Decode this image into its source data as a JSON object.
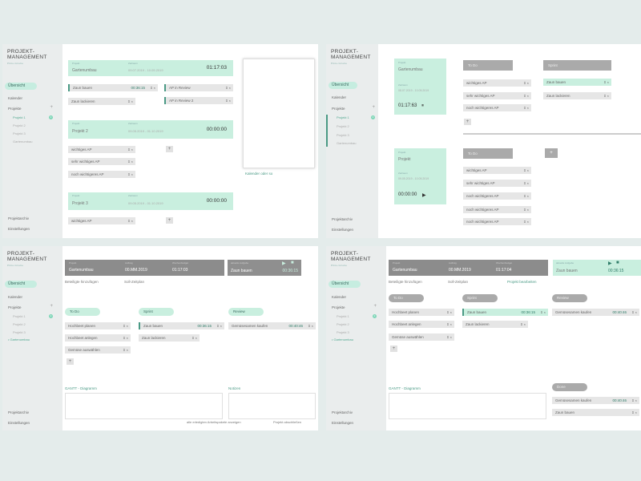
{
  "brand": {
    "title1": "PROJEKT-",
    "title2": "MANAGEMENT",
    "subtitle": "Pikto-Griebe"
  },
  "nav": {
    "overview": "Übersicht",
    "calendar": "Kalender",
    "projects": "Projekte",
    "p1": "Projekt 1",
    "p2": "Projekt 2",
    "p3": "Projekt 3",
    "garden": "Gartenumbau",
    "garden_bullet": "• Gartenumbau",
    "badge": "2",
    "archive": "Projektarchiv",
    "settings": "Einstellungen"
  },
  "labels": {
    "projekt": "Projekt",
    "zeitraum": "Zeitraum",
    "auftrag": "Auftrag",
    "wochenbudget": "Wochenbudget",
    "aktuelle_aufgabe": "aktuelle Aufgabe"
  },
  "ctl": {
    "pri": "⇕ ×",
    "x": "×"
  },
  "p1": {
    "card1": {
      "name": "Gartenumbau",
      "range": "09.07.2019 - 10.05.2019",
      "timer": "01:17:03"
    },
    "tasks1": [
      "Zaun bauen",
      "Zaun lackieren"
    ],
    "task1_time": "00:36:15",
    "side_tasks": [
      "AP in Review",
      "AP in Review 2"
    ],
    "card2": {
      "name": "Projekt 2",
      "range": "09.05.2019 - 01.10.2019",
      "timer": "00:00:00"
    },
    "tasks2": [
      "wichtiges AP",
      "sehr wichtiges AP",
      "noch wichtigeres AP"
    ],
    "card3": {
      "name": "Projekt 3",
      "range": "09.05.2019 - 01.10.2019",
      "timer": "00:00:00"
    },
    "tasks3": [
      "wichtiges AP"
    ],
    "calendar_link": "Kalender oder so"
  },
  "p2": {
    "card1": {
      "name": "Gartenumbau",
      "range": "08.07.2019 - 10.05.2019",
      "timer": "01:17:63",
      "pause": "⏸"
    },
    "todo1": "To Do",
    "todo1_tasks": [
      "wichtiges AP",
      "sehr wichtiges AP",
      "noch wichtigeres AP"
    ],
    "sprint": "Sprint",
    "sprint_tasks": [
      "Zaun bauen",
      "Zaun lackieren"
    ],
    "card2": {
      "name": "Projekt",
      "range": "09.05.2019 - 10.05.2019",
      "timer": "00:00:00",
      "play": "▶"
    },
    "todo2": "To Do",
    "todo2_tasks": [
      "wichtiges AP",
      "sehr wichtiges AP",
      "noch wichtigeres AP",
      "noch wichtigeres AP",
      "noch wichtigeres AP"
    ]
  },
  "p3": {
    "header": {
      "projekt": "Gartenumbau",
      "auftrag": "00.MM.2019",
      "budget": "01:17:03"
    },
    "current": {
      "task": "Zaun bauen",
      "timer": "00:36:15",
      "play": "▶",
      "stop": "■"
    },
    "links": {
      "beteiligte": "Beteiligte hinzufügen",
      "soll": "Soll-Zeitplan"
    },
    "col_todo": "To Do",
    "col_todo_tasks": [
      "Hochbeet planen",
      "Hochbeet anlegen",
      "Gemüse auswählen"
    ],
    "col_sprint": "Sprint",
    "col_sprint_tasks": [
      "Zaun bauen",
      "Zaun lackieren"
    ],
    "sprint_time": "00:36:15",
    "col_review": "Review",
    "col_review_tasks": [
      "Gemüsesamen kaufen"
    ],
    "review_time": "00:40:46",
    "gantt": "GANTT - Diagramm",
    "notes": "Notizen",
    "show_all": "alle erledigten Arbeitspakete anzeigen",
    "finish": "Projekt abschließen"
  },
  "p4": {
    "header": {
      "projekt": "Gartenumbau",
      "auftrag": "00.MM.2019",
      "budget": "01:17:04"
    },
    "current": {
      "task": "Zaun bauen",
      "timer": "00:36:15",
      "play": "▶",
      "stop": "■"
    },
    "links": {
      "beteiligte": "Beteiligte hinzufügen",
      "soll": "Soll-Zeitplan",
      "edit": "Projekt bearbeiten"
    },
    "col_todo": "To Do",
    "col_todo_tasks": [
      "Hochbeet planen",
      "Hochbeet anlegen",
      "Gemüse auswählen"
    ],
    "col_sprint": "Sprint",
    "col_sprint_tasks": [
      "Zaun bauen",
      "Zaun lackieren"
    ],
    "sprint_time": "00:36:15",
    "col_review": "Review",
    "col_review_tasks": [
      "Gemüsesamen kaufen"
    ],
    "review_time": "00:40:46",
    "col_done": "Done",
    "col_done_tasks": [
      "Gemüsesamen kaufen",
      "Zaun bauen"
    ],
    "done_time": "00:40:46",
    "gantt": "GANTT - Diagramm"
  }
}
